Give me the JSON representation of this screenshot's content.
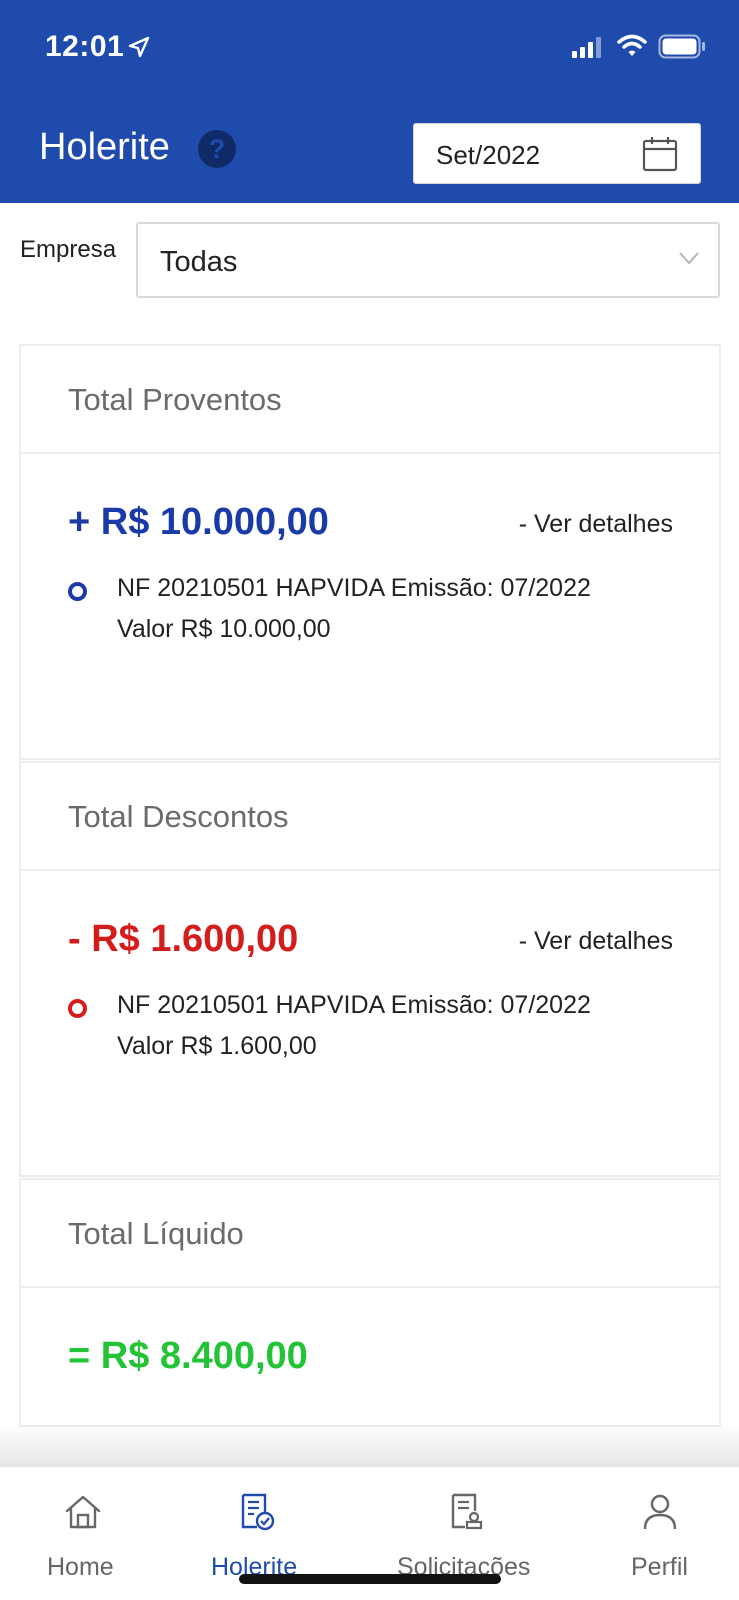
{
  "status_bar": {
    "time": "12:01"
  },
  "header": {
    "title": "Holerite",
    "help_icon": "?",
    "date_value": "Set/2022"
  },
  "filter": {
    "label": "Empresa",
    "selected": "Todas"
  },
  "cards": [
    {
      "title": "Total Proventos",
      "amount": "+ R$ 10.000,00",
      "details_link": "- Ver detalhes",
      "item_line1": "NF 20210501 HAPVIDA Emissão: 07/2022",
      "item_line2": "Valor R$ 10.000,00",
      "color": "#1a3aa8"
    },
    {
      "title": "Total Descontos",
      "amount": "- R$ 1.600,00",
      "details_link": "- Ver detalhes",
      "item_line1": "NF 20210501 HAPVIDA Emissão: 07/2022",
      "item_line2": "Valor R$ 1.600,00",
      "color": "#d41c1c"
    },
    {
      "title": "Total Líquido",
      "amount": "= R$ 8.400,00",
      "color": "#22c435"
    }
  ],
  "tabbar": {
    "items": [
      {
        "label": "Home",
        "icon": "home-icon",
        "active": false
      },
      {
        "label": "Holerite",
        "icon": "payslip-icon",
        "active": true
      },
      {
        "label": "Solicitações",
        "icon": "request-icon",
        "active": false
      },
      {
        "label": "Perfil",
        "icon": "profile-icon",
        "active": false
      }
    ],
    "active_color": "#1f4bad",
    "inactive_color": "#666666"
  },
  "colors": {
    "brand": "#1f4bad",
    "positive": "#1a3aa8",
    "negative": "#d41c1c",
    "net": "#22c435"
  }
}
